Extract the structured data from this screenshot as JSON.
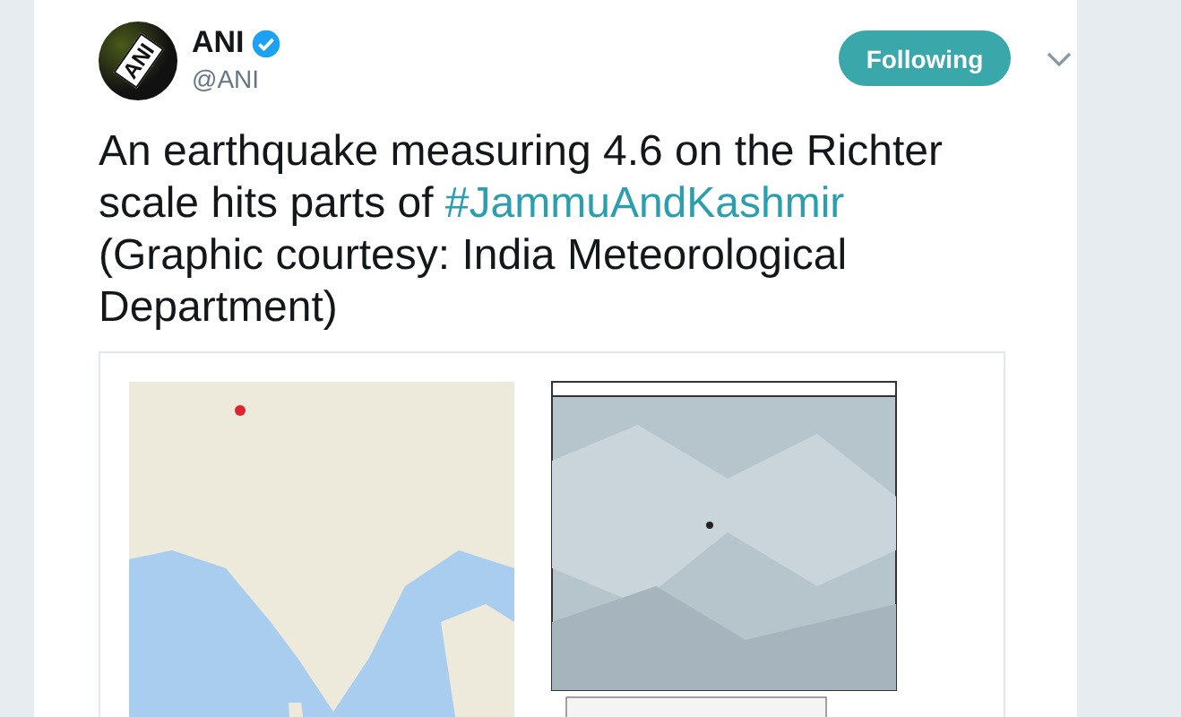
{
  "tweet": {
    "avatar_logo": "ANI",
    "name": "ANI",
    "verified": true,
    "handle": "@ANI",
    "follow_button": {
      "label": "Following",
      "selected": true
    },
    "text_before": "An earthquake measuring 4.6 on the Richter scale hits parts of ",
    "hashtag": "#JammuAndKashmir",
    "text_after": "(Graphic courtesy: India Meteorological Department)"
  }
}
